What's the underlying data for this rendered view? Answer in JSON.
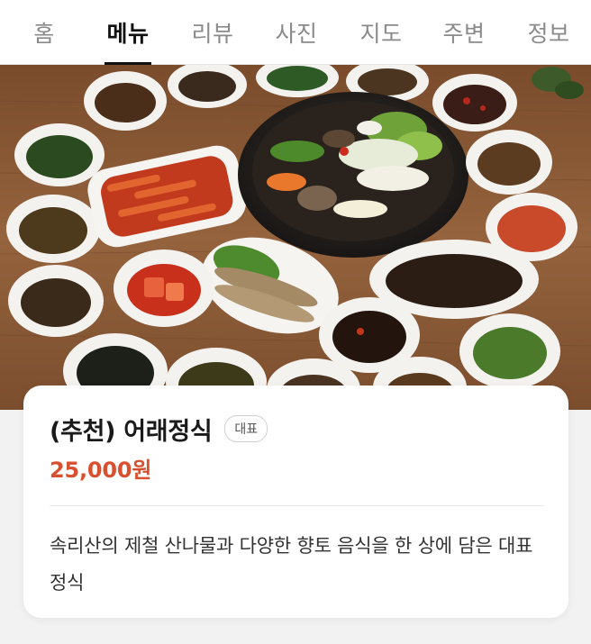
{
  "tabs": [
    {
      "label": "홈",
      "active": false
    },
    {
      "label": "메뉴",
      "active": true
    },
    {
      "label": "리뷰",
      "active": false
    },
    {
      "label": "사진",
      "active": false
    },
    {
      "label": "지도",
      "active": false
    },
    {
      "label": "주변",
      "active": false
    },
    {
      "label": "정보",
      "active": false
    }
  ],
  "menu_item": {
    "name": "(추천) 어래정식",
    "badge": "대표",
    "price": "25,000원",
    "description": "속리산의 제철 산나물과 다양한 향토 음식을 한 상에 담은 대표 정식"
  },
  "colors": {
    "price": "#d8502f",
    "active_tab": "#111111",
    "inactive_tab": "#8a8a8a",
    "table_wood": "#8a5a35"
  },
  "photo": {
    "subject": "korean-table-spread"
  }
}
